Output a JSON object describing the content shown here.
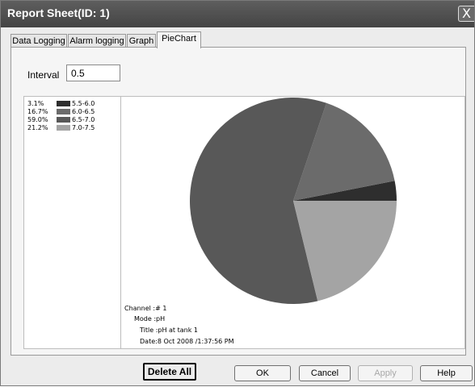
{
  "window": {
    "title": "Report Sheet(ID: 1)",
    "close_label": "X"
  },
  "tabs": [
    {
      "label": "Data Logging",
      "active": false
    },
    {
      "label": "Alarm logging",
      "active": false
    },
    {
      "label": "Graph",
      "active": false
    },
    {
      "label": "PieChart",
      "active": true
    }
  ],
  "interval": {
    "label": "Interval",
    "value": "0.5"
  },
  "legend": [
    {
      "pct": "3.1%",
      "range": "5.5-6.0",
      "color": "#2e2e2e"
    },
    {
      "pct": "16.7%",
      "range": "6.0-6.5",
      "color": "#6b6b6b"
    },
    {
      "pct": "59.0%",
      "range": "6.5-7.0",
      "color": "#585858"
    },
    {
      "pct": "21.2%",
      "range": "7.0-7.5",
      "color": "#a4a4a4"
    }
  ],
  "info": {
    "channel": "Channel :# 1",
    "mode": "Mode :pH",
    "title": "Title :pH at tank 1",
    "date": "Date:8 Oct 2008 /1:37:56 PM"
  },
  "buttons": {
    "delete_all": "Delete All",
    "ok": "OK",
    "cancel": "Cancel",
    "apply": "Apply",
    "help": "Help"
  },
  "chart_data": {
    "type": "pie",
    "categories": [
      "5.5-6.0",
      "6.0-6.5",
      "6.5-7.0",
      "7.0-7.5"
    ],
    "values": [
      3.1,
      16.7,
      59.0,
      21.2
    ],
    "colors": [
      "#2e2e2e",
      "#6b6b6b",
      "#585858",
      "#a4a4a4"
    ],
    "legend": "left"
  }
}
